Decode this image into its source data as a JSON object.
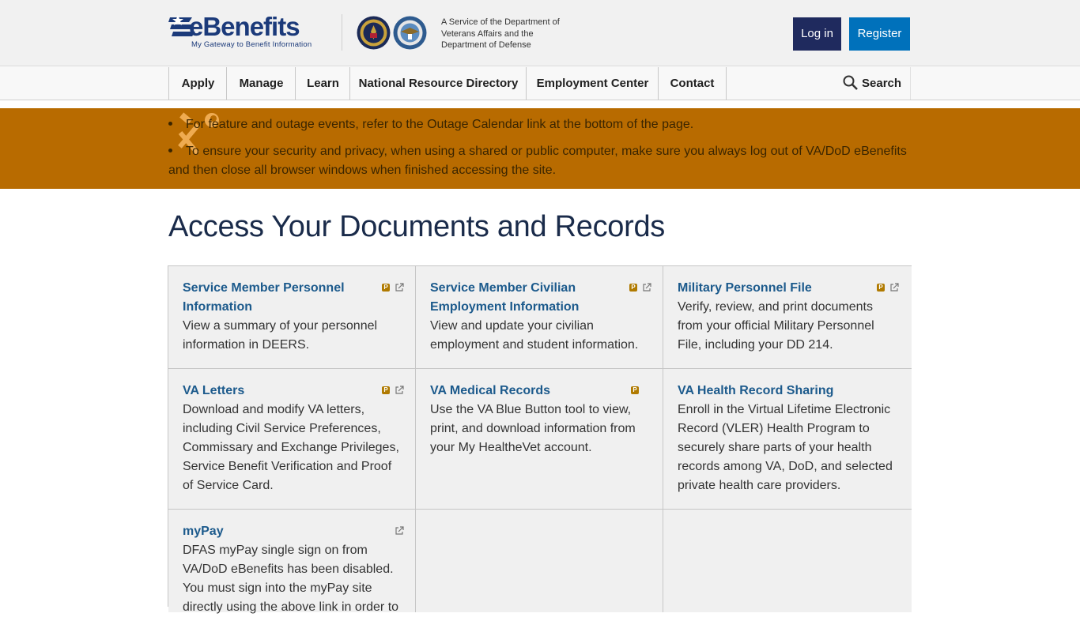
{
  "header": {
    "logo_text": "eBenefits",
    "logo_tagline": "My Gateway to Benefit Information",
    "service_text": "A Service of the Department of Veterans Affairs and the Department of Defense",
    "login_label": "Log in",
    "register_label": "Register"
  },
  "nav": {
    "items": [
      {
        "label": "Apply"
      },
      {
        "label": "Manage"
      },
      {
        "label": "Learn"
      },
      {
        "label": "National Resource Directory"
      },
      {
        "label": "Employment Center"
      },
      {
        "label": "Contact"
      }
    ],
    "search_label": "Search"
  },
  "banner": {
    "messages": [
      "For feature and outage events, refer to the Outage Calendar link at the bottom of the page.",
      "To ensure your security and privacy, when using a shared or public computer, make sure you always log out of VA/DoD eBenefits and then close all browser windows when finished accessing the site."
    ]
  },
  "main": {
    "title": "Access Your Documents and Records",
    "cards": [
      {
        "title": "Service Member Personnel Information",
        "desc": "View a summary of your personnel information in DEERS.",
        "badge": "P"
      },
      {
        "title": "Service Member Civilian Employment Information",
        "desc": "View and update your civilian employment and student information.",
        "badge": "P"
      },
      {
        "title": "Military Personnel File",
        "desc": "Verify, review, and print documents from your official Military Personnel File, including your DD 214.",
        "badge": "P"
      },
      {
        "title": "VA Letters",
        "desc": "Download and modify VA letters, including Civil Service Preferences, Commissary and Exchange Privileges, Service Benefit Verification and Proof of Service Card.",
        "badge": "P"
      },
      {
        "title": "VA Medical Records",
        "desc": "Use the VA Blue Button tool to view, print, and download information from your My HealtheVet account.",
        "badge": "P"
      },
      {
        "title": "VA Health Record Sharing",
        "desc": "Enroll in the Virtual Lifetime Electronic Record (VLER) Health Program to securely share parts of your health records among VA, DoD, and selected private health care providers."
      },
      {
        "title": "myPay",
        "desc": "DFAS myPay single sign on from VA/DoD eBenefits has been disabled. You must sign into the myPay site directly using the above link in order to"
      }
    ]
  },
  "colors": {
    "banner": "#b86b00",
    "brand_navy": "#1f2a5e",
    "brand_blue": "#0071bb",
    "link": "#1c5a8c"
  }
}
